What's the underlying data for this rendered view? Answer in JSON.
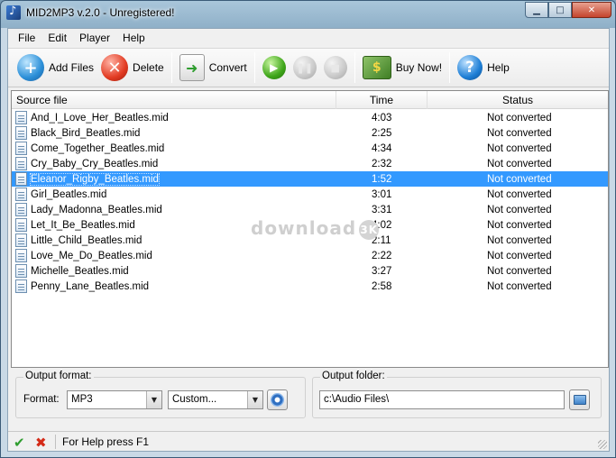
{
  "window": {
    "title": "MID2MP3 v.2.0 - Unregistered!"
  },
  "menu": [
    "File",
    "Edit",
    "Player",
    "Help"
  ],
  "toolbar": {
    "add_files": "Add Files",
    "delete": "Delete",
    "convert": "Convert",
    "buy_now": "Buy Now!",
    "help": "Help"
  },
  "list": {
    "columns": [
      "Source file",
      "Time",
      "Status"
    ],
    "rows": [
      {
        "file": "And_I_Love_Her_Beatles.mid",
        "time": "4:03",
        "status": "Not converted"
      },
      {
        "file": "Black_Bird_Beatles.mid",
        "time": "2:25",
        "status": "Not converted"
      },
      {
        "file": "Come_Together_Beatles.mid",
        "time": "4:34",
        "status": "Not converted"
      },
      {
        "file": "Cry_Baby_Cry_Beatles.mid",
        "time": "2:32",
        "status": "Not converted"
      },
      {
        "file": "Eleanor_Rigby_Beatles.mid",
        "time": "1:52",
        "status": "Not converted",
        "selected": true
      },
      {
        "file": "Girl_Beatles.mid",
        "time": "3:01",
        "status": "Not converted"
      },
      {
        "file": "Lady_Madonna_Beatles.mid",
        "time": "3:31",
        "status": "Not converted"
      },
      {
        "file": "Let_It_Be_Beatles.mid",
        "time": "4:02",
        "status": "Not converted"
      },
      {
        "file": "Little_Child_Beatles.mid",
        "time": "2:11",
        "status": "Not converted"
      },
      {
        "file": "Love_Me_Do_Beatles.mid",
        "time": "2:22",
        "status": "Not converted"
      },
      {
        "file": "Michelle_Beatles.mid",
        "time": "3:27",
        "status": "Not converted"
      },
      {
        "file": "Penny_Lane_Beatles.mid",
        "time": "2:58",
        "status": "Not converted"
      }
    ]
  },
  "watermark": "download",
  "output_format": {
    "group_label": "Output format:",
    "format_label": "Format:",
    "format_value": "MP3",
    "preset_value": "Custom..."
  },
  "output_folder": {
    "group_label": "Output folder:",
    "path": "c:\\Audio Files\\"
  },
  "statusbar": {
    "text": "For Help press F1"
  },
  "colors": {
    "selection": "#3399ff",
    "titlebar": "#a9c6da"
  }
}
